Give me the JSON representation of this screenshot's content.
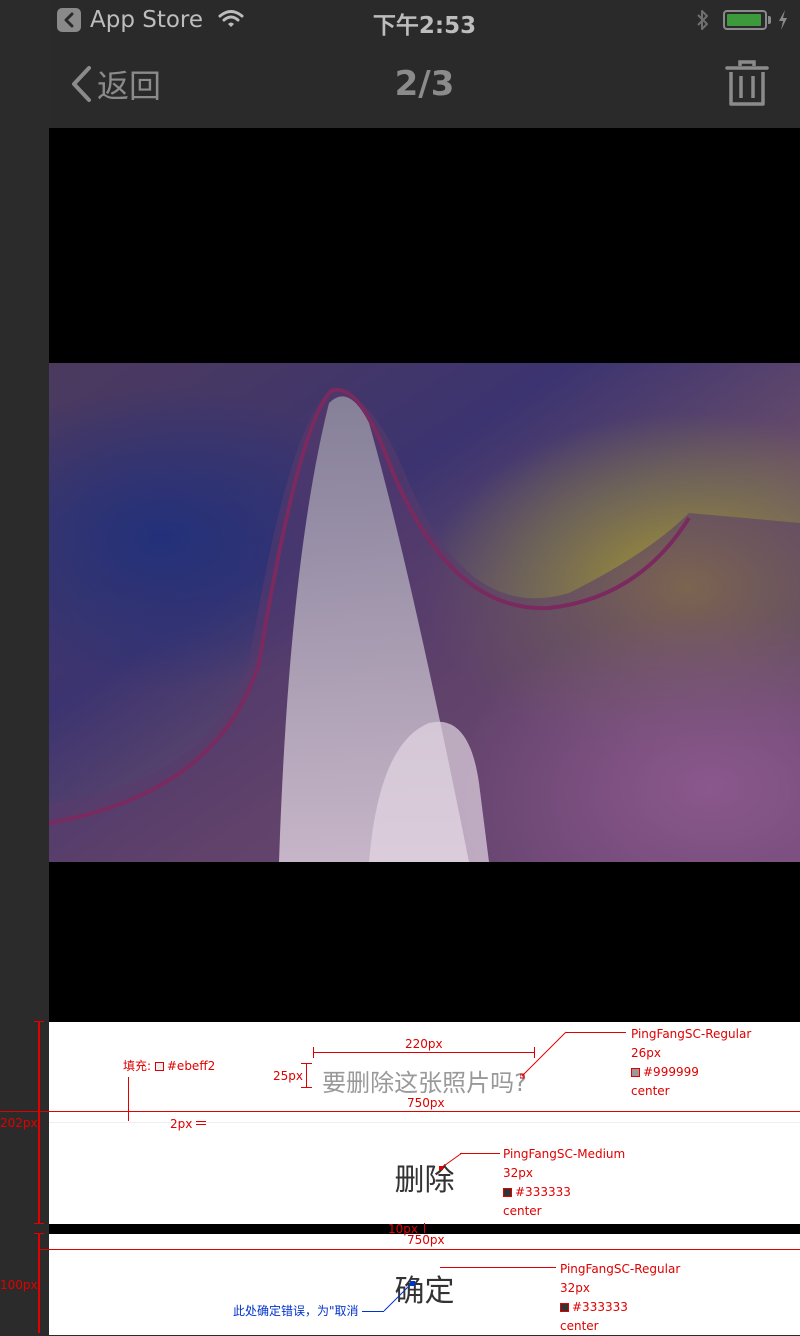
{
  "status_bar": {
    "back_app": "App Store",
    "time": "下午2:53",
    "battery_level": 0.95
  },
  "nav": {
    "back_label": "返回",
    "title": "2/3",
    "trash_icon": "trash-icon"
  },
  "photo": {
    "description_icon": "abstract-swirl-photo"
  },
  "action_sheet": {
    "title": "要删除这张照片吗?",
    "delete_label": "删除",
    "confirm_label": "确定"
  },
  "annotations": {
    "fill_label": "填充:",
    "fill_color": "#ebeff2",
    "width_220": "220px",
    "height_25": "25px",
    "width_750_a": "750px",
    "total_202": "202px",
    "divider_2": "2px",
    "title_font": "PingFangSC-Regular",
    "title_size": "26px",
    "title_color": "#999999",
    "title_align": "center",
    "delete_font": "PingFangSC-Medium",
    "delete_size": "32px",
    "delete_color": "#333333",
    "delete_align": "center",
    "gap_10": "10px",
    "width_750_b": "750px",
    "height_100": "100px",
    "confirm_font": "PingFangSC-Regular",
    "confirm_size": "32px",
    "confirm_color": "#333333",
    "confirm_align": "center",
    "confirm_note": "此处确定错误，为\"取消"
  },
  "colors": {
    "annotation_red": "#e00000",
    "annotation_blue": "#0033cc",
    "bar_background": "#2a2a2a"
  }
}
